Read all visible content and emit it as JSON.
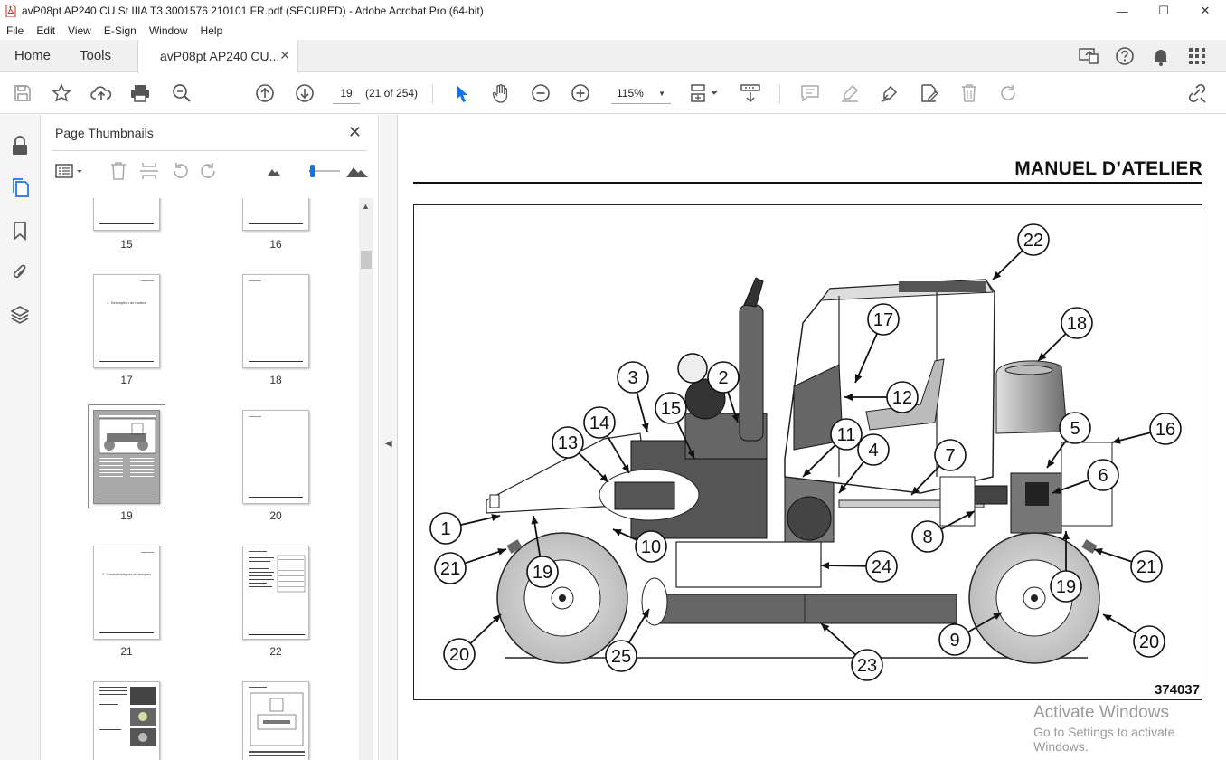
{
  "window": {
    "title": "avP08pt AP240 CU St IIIA T3 3001576 210101 FR.pdf (SECURED) - Adobe Acrobat Pro (64-bit)",
    "minimize": "—",
    "maximize": "☐",
    "close": "✕"
  },
  "menu": [
    "File",
    "Edit",
    "View",
    "E-Sign",
    "Window",
    "Help"
  ],
  "tabs": {
    "home": "Home",
    "tools": "Tools",
    "doc": "avP08pt AP240 CU...",
    "doc_close": "✕"
  },
  "toolbar": {
    "page_number": "19",
    "page_count": "(21 of 254)",
    "zoom": "115%"
  },
  "panel": {
    "title": "Page Thumbnails",
    "close": "✕",
    "thumbnails": [
      {
        "label": "15"
      },
      {
        "label": "16"
      },
      {
        "label": "17",
        "text": "1. Description du moteur"
      },
      {
        "label": "18"
      },
      {
        "label": "19"
      },
      {
        "label": "20"
      },
      {
        "label": "21",
        "text": "2. Caractéristiques techniques"
      },
      {
        "label": "22"
      },
      {
        "label": ""
      },
      {
        "label": ""
      }
    ]
  },
  "document": {
    "header": "MANUEL D’ATELIER",
    "figure_number": "374037",
    "callouts": [
      "1",
      "2",
      "3",
      "4",
      "5",
      "6",
      "7",
      "8",
      "9",
      "10",
      "11",
      "12",
      "13",
      "14",
      "15",
      "16",
      "17",
      "18",
      "19",
      "19",
      "20",
      "20",
      "21",
      "21",
      "22",
      "23",
      "24",
      "25"
    ]
  },
  "watermark": {
    "line1": "Activate Windows",
    "line2": "Go to Settings to activate Windows."
  },
  "colors": {
    "accent": "#1473e6",
    "acrobat_red": "#d7281c",
    "tire_gray": "#cfcfcf"
  }
}
